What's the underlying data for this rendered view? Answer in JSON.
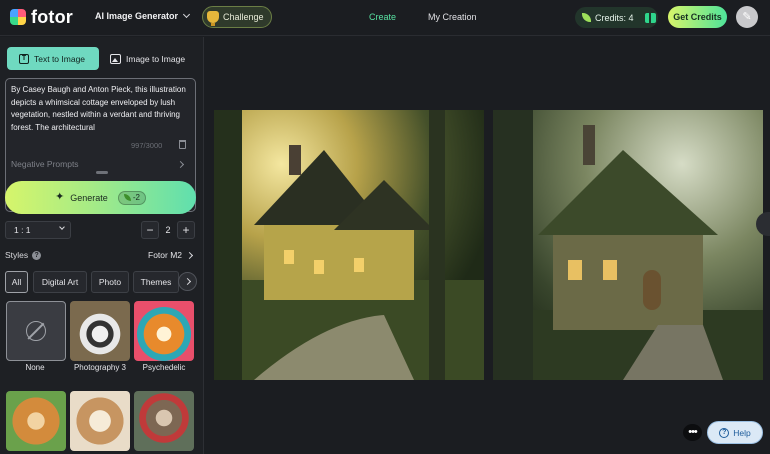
{
  "header": {
    "logo_text": "fotor",
    "tool_dropdown": "AI Image Generator",
    "challenge_label": "Challenge",
    "nav": {
      "create": "Create",
      "my_creation": "My Creation"
    },
    "credits_label": "Credits: 4",
    "get_credits_label": "Get Credits",
    "avatar_glyph": "✎"
  },
  "mode_tabs": {
    "text_to_image": "Text to Image",
    "image_to_image": "Image to Image"
  },
  "prompt": {
    "text": "By Casey Baugh and Anton Pieck, this illustration depicts a whimsical cottage enveloped by lush vegetation, nestled within a verdant and thriving forest. The architectural",
    "char_count": "997/3000",
    "negative_label": "Negative Prompts"
  },
  "generate": {
    "label": "Generate",
    "cost": "-2"
  },
  "settings": {
    "ratio": "1 : 1",
    "count": "2"
  },
  "styles": {
    "label": "Styles",
    "model": "Fotor M2",
    "tabs": [
      "All",
      "Digital Art",
      "Photo",
      "Themes"
    ],
    "thumbnails": [
      {
        "label": "None",
        "icon": "none-icon"
      },
      {
        "label": "Photography 3"
      },
      {
        "label": "Psychedelic"
      }
    ]
  },
  "help_label": "Help",
  "colors": {
    "accent_green": "#58e2a2",
    "generate_gradient_start": "#d6f56b",
    "generate_gradient_end": "#5fdfae",
    "tab_active": "#6fd9c0"
  }
}
